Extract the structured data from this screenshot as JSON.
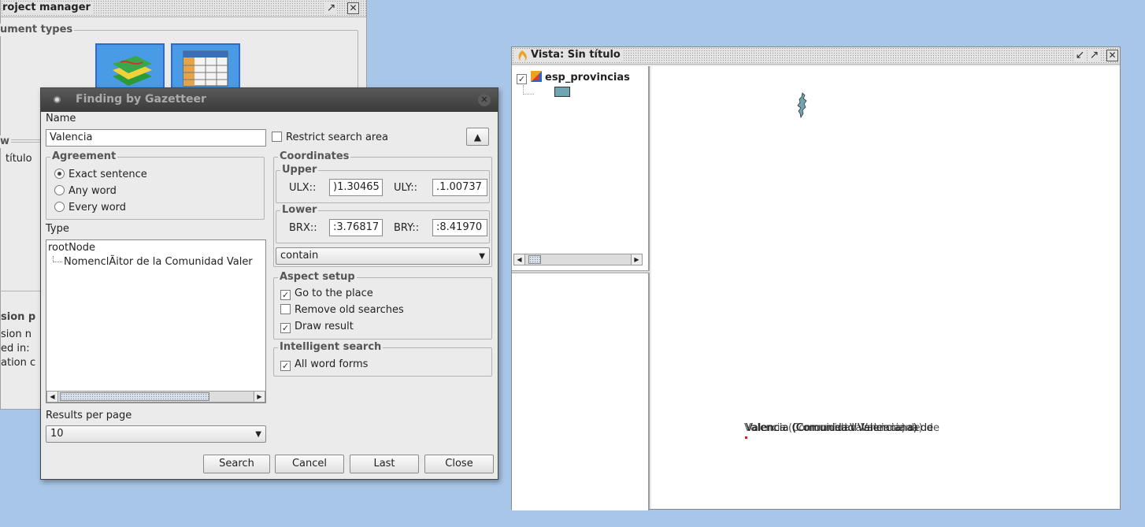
{
  "project_manager": {
    "title": "roject manager",
    "document_types_label": "ument types",
    "views_label": "w",
    "view_item": "título",
    "session_label": "sion p",
    "session_lines": [
      "sion n",
      "ed in:",
      "ation c"
    ]
  },
  "gazetteer": {
    "title": "Finding by Gazetteer",
    "name_label": "Name",
    "name_value": "Valencia",
    "restrict_label": "Restrict search area",
    "agreement": {
      "legend": "Agreement",
      "options": [
        "Exact sentence",
        "Any word",
        "Every word"
      ],
      "selected": "Exact sentence"
    },
    "type_label": "Type",
    "tree": {
      "root": "rootNode",
      "child": "NomenclÃitor de la Comunidad Valer"
    },
    "coordinates": {
      "legend": "Coordinates",
      "upper_legend": "Upper",
      "ulx_label": "ULX::",
      "ulx_value": ")1.30465",
      "uly_label": "ULY::",
      "uly_value": ".1.00737",
      "lower_legend": "Lower",
      "brx_label": "BRX::",
      "brx_value": ":3.76817",
      "bry_label": "BRY::",
      "bry_value": ":8.41970",
      "mode_value": "contain"
    },
    "aspect": {
      "legend": "Aspect setup",
      "go_to_place": "Go to the place",
      "remove_old": "Remove old searches",
      "draw_result": "Draw result",
      "go_to_place_checked": true,
      "remove_old_checked": false,
      "draw_result_checked": true
    },
    "intelligent": {
      "legend": "Intelligent search",
      "all_word_forms": "All word forms",
      "all_word_forms_checked": true
    },
    "results_label": "Results per page",
    "results_value": "10",
    "buttons": {
      "search": "Search",
      "cancel": "Cancel",
      "last": "Last",
      "close": "Close"
    }
  },
  "view_window": {
    "title": "Vista: Sin título",
    "layer_name": "esp_provincias",
    "layer_color": "#6fa6b3",
    "overlap_label": "Valencia (Comunidad Valenciana) de",
    "marker_color": "#d42020"
  }
}
